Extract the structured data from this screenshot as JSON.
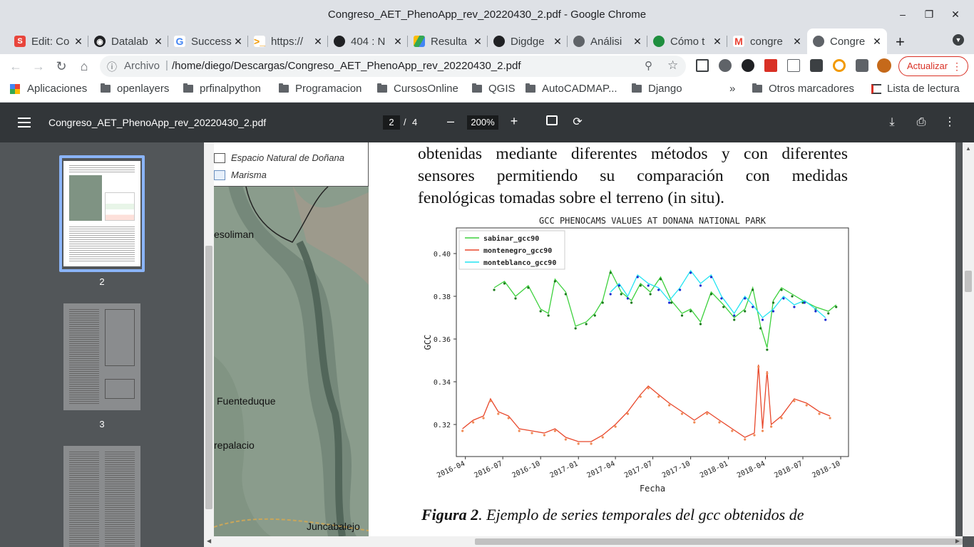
{
  "window": {
    "title": "Congreso_AET_PhenoApp_rev_20220430_2.pdf - Google Chrome"
  },
  "tabs": [
    {
      "label": "Edit: Co",
      "icon": "S",
      "color": "#e8453c"
    },
    {
      "label": "Datalab",
      "icon": "D",
      "color": "#202124"
    },
    {
      "label": "Success",
      "icon": "G",
      "color": "#4285f4"
    },
    {
      "label": "https://",
      "icon": ">",
      "color": "#f29900"
    },
    {
      "label": "404 : N",
      "icon": "gh",
      "color": "#202124"
    },
    {
      "label": "Resulta",
      "icon": "dr",
      "color": "#34a853"
    },
    {
      "label": "Digdge",
      "icon": "gh",
      "color": "#202124"
    },
    {
      "label": "Análisi",
      "icon": "w",
      "color": "#5f6368"
    },
    {
      "label": "Cómo t",
      "icon": "e",
      "color": "#1e8e3e"
    },
    {
      "label": "congre",
      "icon": "M",
      "color": "#ea4335"
    },
    {
      "label": "Congre",
      "icon": "w",
      "color": "#5f6368"
    }
  ],
  "omnibox": {
    "scheme": "Archivo",
    "url": "/home/diego/Descargas/Congreso_AET_PhenoApp_rev_20220430_2.pdf"
  },
  "update_label": "Actualizar",
  "bookmarks": [
    "Aplicaciones",
    "openlayers",
    "prfinalpython",
    "Programacion",
    "CursosOnline",
    "QGIS",
    "AutoCADMAP...",
    "Django",
    "»",
    "Otros marcadores",
    "Lista de lectura"
  ],
  "pdf": {
    "filename": "Congreso_AET_PhenoApp_rev_20220430_2.pdf",
    "page": "2",
    "sep": "/",
    "total": "4",
    "zoom": "200%"
  },
  "thumbs": [
    "2",
    "3"
  ],
  "map": {
    "legend": [
      "Espacio Natural de Doñana",
      "Marisma"
    ],
    "places": [
      "esoliman",
      "Fuenteduque",
      "repalacio",
      "Juncabalejo"
    ]
  },
  "text": {
    "line1": "obtenidas mediante diferentes métodos y con diferentes",
    "line2": "sensores permitiendo su comparación con medidas",
    "line3": "fenológicas tomadas sobre el terreno (in situ).",
    "cap_bold": "Figura 2",
    "cap_rest": ". Ejemplo de series temporales del gcc obtenidos de"
  },
  "chart_data": {
    "type": "line",
    "title": "GCC PHENOCAMS VALUES AT DONANA NATIONAL PARK",
    "xlabel": "Fecha",
    "ylabel": "GCC",
    "ylim": [
      0.305,
      0.412
    ],
    "xlim": [
      "2016-03-10",
      "2018-10-20"
    ],
    "yticks": [
      "0.32",
      "0.34",
      "0.36",
      "0.38",
      "0.40"
    ],
    "xticks": [
      "2016-04",
      "2016-07",
      "2016-10",
      "2017-01",
      "2017-04",
      "2017-07",
      "2017-10",
      "2018-01",
      "2018-04",
      "2018-07",
      "2018-10"
    ],
    "legend_position": "top-left",
    "series": [
      {
        "name": "sabinar_gcc90",
        "color": "#3dd13d",
        "dot_color": "#1a7a1a",
        "points": [
          [
            "2016-06-10",
            0.384
          ],
          [
            "2016-07-05",
            0.387
          ],
          [
            "2016-08-01",
            0.38
          ],
          [
            "2016-09-01",
            0.385
          ],
          [
            "2016-10-01",
            0.374
          ],
          [
            "2016-10-20",
            0.372
          ],
          [
            "2016-11-05",
            0.388
          ],
          [
            "2016-12-01",
            0.382
          ],
          [
            "2016-12-25",
            0.366
          ],
          [
            "2017-01-20",
            0.368
          ],
          [
            "2017-02-10",
            0.372
          ],
          [
            "2017-03-01",
            0.378
          ],
          [
            "2017-03-20",
            0.392
          ],
          [
            "2017-04-15",
            0.382
          ],
          [
            "2017-05-10",
            0.378
          ],
          [
            "2017-06-01",
            0.386
          ],
          [
            "2017-06-25",
            0.382
          ],
          [
            "2017-07-20",
            0.389
          ],
          [
            "2017-08-15",
            0.378
          ],
          [
            "2017-09-10",
            0.372
          ],
          [
            "2017-10-01",
            0.374
          ],
          [
            "2017-10-25",
            0.368
          ],
          [
            "2017-11-20",
            0.382
          ],
          [
            "2017-12-20",
            0.376
          ],
          [
            "2018-01-15",
            0.37
          ],
          [
            "2018-02-10",
            0.374
          ],
          [
            "2018-03-01",
            0.384
          ],
          [
            "2018-03-20",
            0.366
          ],
          [
            "2018-04-05",
            0.356
          ],
          [
            "2018-04-20",
            0.378
          ],
          [
            "2018-05-10",
            0.384
          ],
          [
            "2018-06-05",
            0.381
          ],
          [
            "2018-07-01",
            0.378
          ],
          [
            "2018-08-01",
            0.375
          ],
          [
            "2018-09-01",
            0.373
          ],
          [
            "2018-09-20",
            0.376
          ]
        ]
      },
      {
        "name": "montenegro_gcc90",
        "color": "#e8472b",
        "dot_color": "#f08a55",
        "points": [
          [
            "2016-03-25",
            0.318
          ],
          [
            "2016-04-20",
            0.322
          ],
          [
            "2016-05-15",
            0.324
          ],
          [
            "2016-06-01",
            0.332
          ],
          [
            "2016-06-20",
            0.326
          ],
          [
            "2016-07-15",
            0.324
          ],
          [
            "2016-08-10",
            0.318
          ],
          [
            "2016-09-10",
            0.317
          ],
          [
            "2016-10-10",
            0.316
          ],
          [
            "2016-11-05",
            0.318
          ],
          [
            "2016-12-01",
            0.314
          ],
          [
            "2017-01-01",
            0.312
          ],
          [
            "2017-02-01",
            0.312
          ],
          [
            "2017-03-01",
            0.315
          ],
          [
            "2017-04-01",
            0.32
          ],
          [
            "2017-05-01",
            0.326
          ],
          [
            "2017-06-01",
            0.334
          ],
          [
            "2017-06-20",
            0.338
          ],
          [
            "2017-07-15",
            0.334
          ],
          [
            "2017-08-10",
            0.33
          ],
          [
            "2017-09-10",
            0.326
          ],
          [
            "2017-10-10",
            0.322
          ],
          [
            "2017-11-10",
            0.326
          ],
          [
            "2017-12-10",
            0.322
          ],
          [
            "2018-01-10",
            0.318
          ],
          [
            "2018-02-10",
            0.314
          ],
          [
            "2018-03-05",
            0.316
          ],
          [
            "2018-03-15",
            0.348
          ],
          [
            "2018-03-25",
            0.318
          ],
          [
            "2018-04-05",
            0.345
          ],
          [
            "2018-04-15",
            0.32
          ],
          [
            "2018-05-10",
            0.324
          ],
          [
            "2018-06-10",
            0.332
          ],
          [
            "2018-07-10",
            0.33
          ],
          [
            "2018-08-10",
            0.326
          ],
          [
            "2018-09-05",
            0.324
          ]
        ]
      },
      {
        "name": "monteblanco_gcc90",
        "color": "#22e4f2",
        "dot_color": "#1a2ad1",
        "points": [
          [
            "2017-03-20",
            0.382
          ],
          [
            "2017-04-10",
            0.386
          ],
          [
            "2017-05-01",
            0.38
          ],
          [
            "2017-05-25",
            0.39
          ],
          [
            "2017-06-20",
            0.386
          ],
          [
            "2017-07-15",
            0.384
          ],
          [
            "2017-08-10",
            0.378
          ],
          [
            "2017-09-05",
            0.384
          ],
          [
            "2017-10-01",
            0.392
          ],
          [
            "2017-10-25",
            0.386
          ],
          [
            "2017-11-20",
            0.39
          ],
          [
            "2017-12-15",
            0.38
          ],
          [
            "2018-01-15",
            0.372
          ],
          [
            "2018-02-10",
            0.38
          ],
          [
            "2018-03-01",
            0.376
          ],
          [
            "2018-03-25",
            0.37
          ],
          [
            "2018-04-20",
            0.374
          ],
          [
            "2018-05-15",
            0.38
          ],
          [
            "2018-06-10",
            0.376
          ],
          [
            "2018-07-05",
            0.378
          ],
          [
            "2018-08-01",
            0.374
          ],
          [
            "2018-08-25",
            0.37
          ]
        ]
      }
    ]
  }
}
